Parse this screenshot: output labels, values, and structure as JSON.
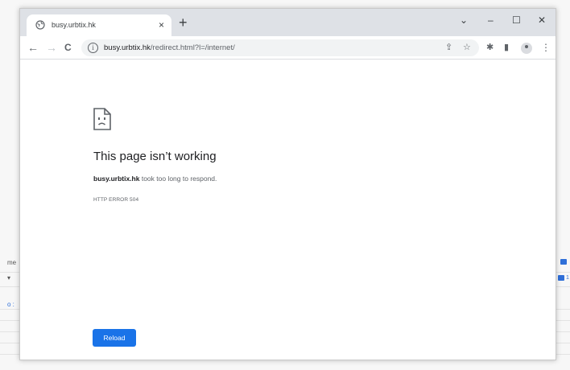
{
  "background_app": {
    "side_label_1": "me",
    "side_label_2": "▾",
    "side_label_3": "o :",
    "badge_1": "",
    "badge_2": "1"
  },
  "browser": {
    "tab": {
      "title": "busy.urbtix.hk",
      "close_glyph": "×",
      "favicon": "globe-icon"
    },
    "new_tab_glyph": "+",
    "window_controls": {
      "tab_search": "⌄",
      "minimize": "–",
      "maximize": "☐",
      "close": "✕"
    },
    "nav": {
      "back": "←",
      "forward": "→",
      "reload": "C"
    },
    "omnibox": {
      "host": "busy.urbtix.hk",
      "path": "/redirect.html?l=/internet/",
      "info_glyph": "i"
    },
    "toolbar_icons": {
      "share": "⇪",
      "bookmark": "☆",
      "extensions": "✱",
      "side_panel": "▮",
      "menu": "⋮"
    }
  },
  "error_page": {
    "icon": "sad-page-icon",
    "heading": "This page isn’t working",
    "desc_host": "busy.urbtix.hk",
    "desc_rest": " took too long to respond.",
    "error_code": "HTTP ERROR 504",
    "reload_label": "Reload",
    "reload_color": "#1a73e8"
  }
}
